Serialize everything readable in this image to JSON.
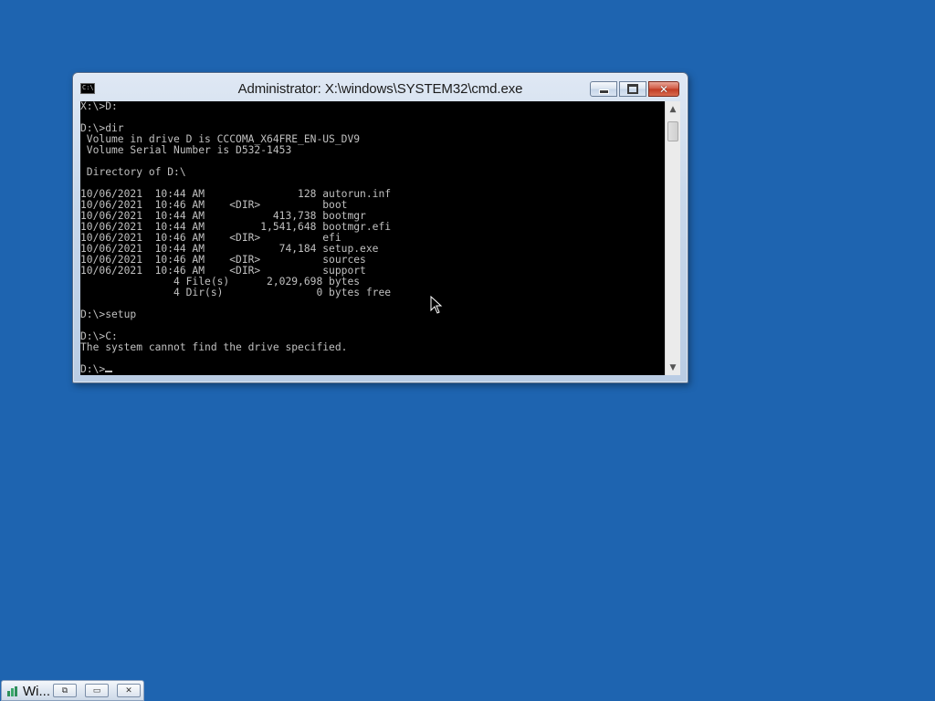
{
  "desktop": {
    "background_color": "#1e64b0"
  },
  "window": {
    "title": "Administrator: X:\\windows\\SYSTEM32\\cmd.exe",
    "icon": "cmd-icon",
    "icon_text": "C:\\",
    "buttons": {
      "minimize": "minimize-icon",
      "maximize": "maximize-icon",
      "close": "close-icon",
      "close_glyph": "✕"
    }
  },
  "console": {
    "text_color": "#c0c0c0",
    "background_color": "#000000",
    "lines": [
      "X:\\>D:",
      "",
      "D:\\>dir",
      " Volume in drive D is CCCOMA_X64FRE_EN-US_DV9",
      " Volume Serial Number is D532-1453",
      "",
      " Directory of D:\\",
      "",
      "10/06/2021  10:44 AM               128 autorun.inf",
      "10/06/2021  10:46 AM    <DIR>          boot",
      "10/06/2021  10:44 AM           413,738 bootmgr",
      "10/06/2021  10:44 AM         1,541,648 bootmgr.efi",
      "10/06/2021  10:46 AM    <DIR>          efi",
      "10/06/2021  10:44 AM            74,184 setup.exe",
      "10/06/2021  10:46 AM    <DIR>          sources",
      "10/06/2021  10:46 AM    <DIR>          support",
      "               4 File(s)      2,029,698 bytes",
      "               4 Dir(s)               0 bytes free",
      "",
      "D:\\>setup",
      "",
      "D:\\>C:",
      "The system cannot find the drive specified.",
      "",
      "D:\\>"
    ]
  },
  "scrollbar": {
    "up_arrow": "▲",
    "down_arrow": "▼"
  },
  "taskbar": {
    "minimized_window_label": "Wi...",
    "buttons": {
      "restore": "restore-icon",
      "maximize": "maximize-icon",
      "close": "close-icon",
      "restore_glyph": "⧉",
      "maximize_glyph": "▭",
      "close_glyph": "✕"
    }
  }
}
